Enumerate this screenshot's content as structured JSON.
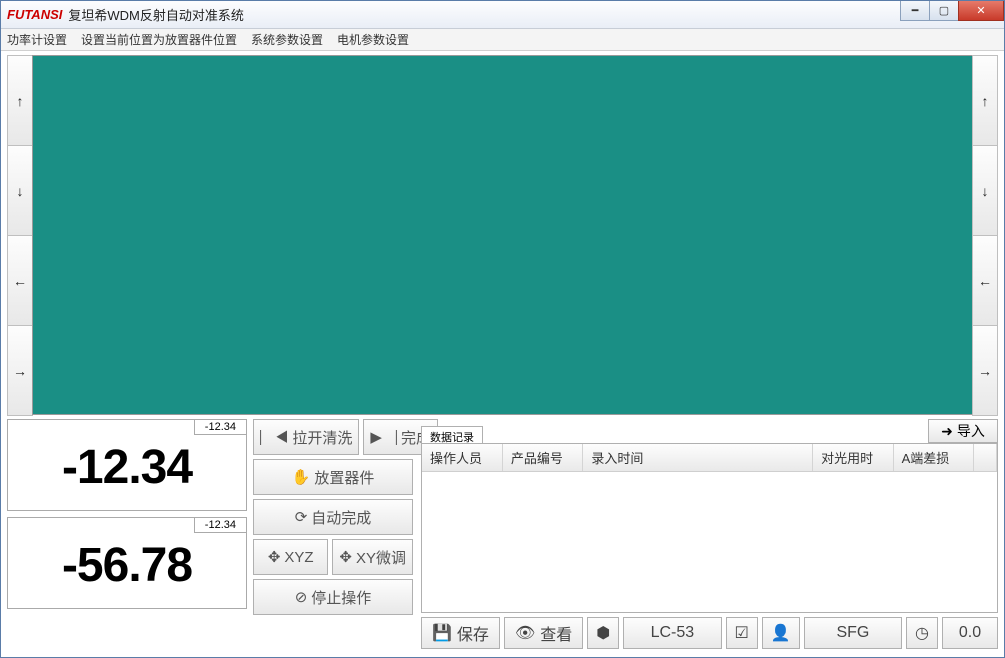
{
  "window": {
    "logo": "FUTANSI",
    "title": "复坦希WDM反射自动对准系统"
  },
  "menu": {
    "item1": "功率计设置",
    "item2": "设置当前位置为放置器件位置",
    "item3": "系统参数设置",
    "item4": "电机参数设置"
  },
  "readout1": {
    "small": "-12.34",
    "big": "-12.34"
  },
  "readout2": {
    "small": "-12.34",
    "big": "-56.78"
  },
  "ops": {
    "pull_clean": "拉开清洗",
    "done": "完成",
    "place": "放置器件",
    "auto": "自动完成",
    "xyz": "XYZ",
    "xyfine": "XY微调",
    "stop": "停止操作"
  },
  "right": {
    "import": "导入",
    "tab": "数据记录",
    "columns": {
      "c1": "操作人员",
      "c2": "产品编号",
      "c3": "录入时间",
      "c4": "对光用时",
      "c5": "A端差损"
    }
  },
  "bottom": {
    "save": "保存",
    "view": "查看",
    "product": "LC-53",
    "operator": "SFG",
    "time": "0.0"
  }
}
